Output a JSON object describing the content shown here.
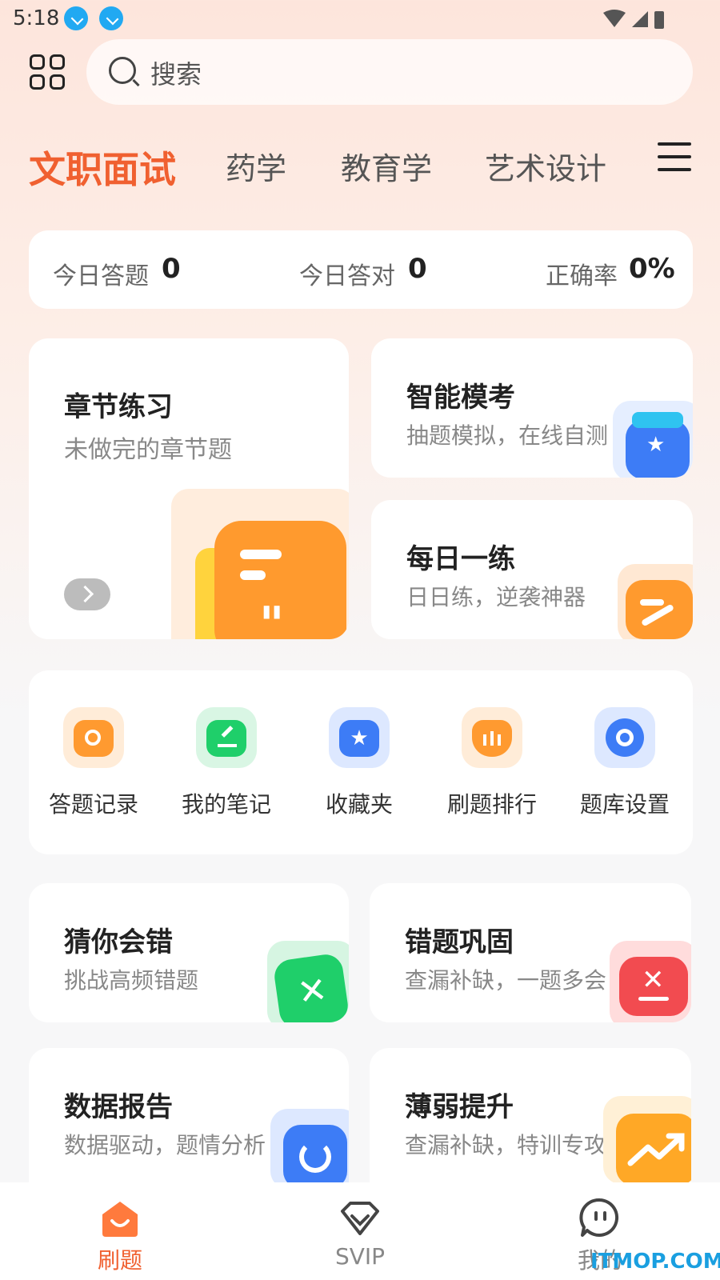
{
  "status_bar": {
    "time": "5:18"
  },
  "search": {
    "placeholder": "搜索"
  },
  "tabs": [
    {
      "label": "文职面试",
      "active": true
    },
    {
      "label": "药学"
    },
    {
      "label": "教育学"
    },
    {
      "label": "艺术设计"
    }
  ],
  "stats": {
    "answered_label": "今日答题",
    "answered_value": "0",
    "correct_label": "今日答对",
    "correct_value": "0",
    "rate_label": "正确率",
    "rate_value": "0%"
  },
  "features": {
    "chapter": {
      "title": "章节练习",
      "subtitle": "未做完的章节题"
    },
    "mock": {
      "title": "智能模考",
      "subtitle": "抽题模拟，在线自测"
    },
    "daily": {
      "title": "每日一练",
      "subtitle": "日日练，逆袭神器"
    }
  },
  "tools": [
    {
      "label": "答题记录",
      "icon": "search-record-icon",
      "color": "#ff9a30"
    },
    {
      "label": "我的笔记",
      "icon": "note-icon",
      "color": "#1fcf6a"
    },
    {
      "label": "收藏夹",
      "icon": "star-icon",
      "color": "#3d7cf6"
    },
    {
      "label": "刷题排行",
      "icon": "ranking-icon",
      "color": "#ff9a30"
    },
    {
      "label": "题库设置",
      "icon": "gear-icon",
      "color": "#3d7cf6"
    }
  ],
  "practice": {
    "guess": {
      "title": "猜你会错",
      "subtitle": "挑战高频错题"
    },
    "wrong": {
      "title": "错题巩固",
      "subtitle": "查漏补缺，一题多会"
    },
    "report": {
      "title": "数据报告",
      "subtitle": "数据驱动，题情分析"
    },
    "weak": {
      "title": "薄弱提升",
      "subtitle": "查漏补缺，特训专攻"
    }
  },
  "bottom_nav": [
    {
      "label": "刷题",
      "active": true
    },
    {
      "label": "SVIP"
    },
    {
      "label": "我的"
    }
  ],
  "watermark": "ITMOP.COM",
  "colors": {
    "accent": "#f06030",
    "orange": "#ff9a30",
    "green": "#1fcf6a",
    "blue": "#3d7cf6",
    "red": "#f24b50"
  }
}
